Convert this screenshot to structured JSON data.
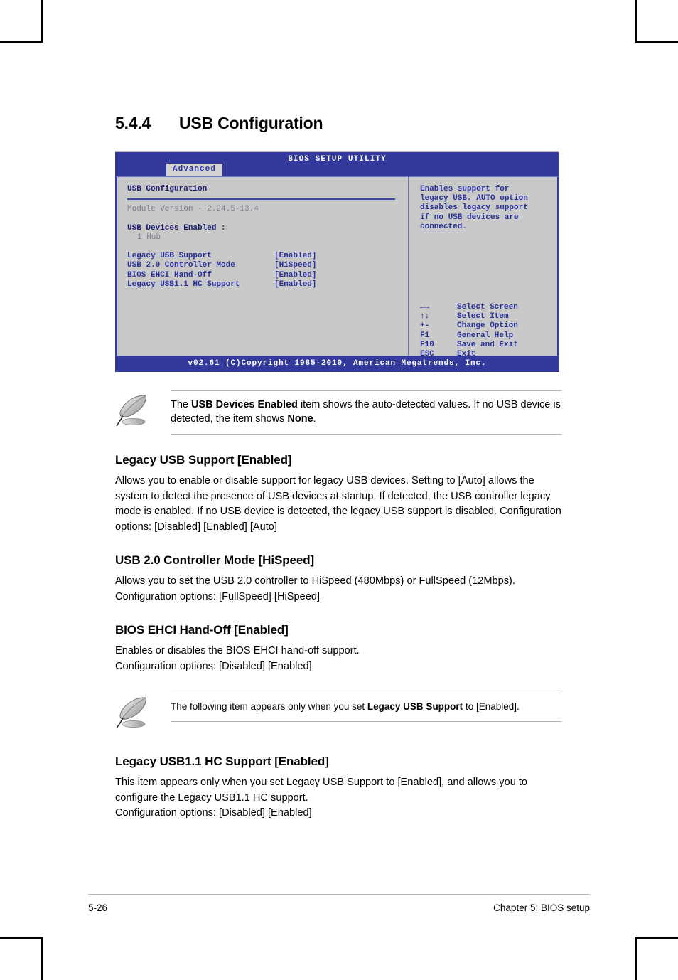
{
  "section": {
    "number": "5.4.4",
    "title": "USB Configuration"
  },
  "bios": {
    "title": "BIOS SETUP UTILITY",
    "active_tab": "Advanced",
    "panel_heading": "USB Configuration",
    "module_version": "Module Version - 2.24.5-13.4",
    "devices_label": "USB Devices Enabled :",
    "devices_value": "1 Hub",
    "options": [
      {
        "name": "Legacy USB Support",
        "value": "[Enabled]"
      },
      {
        "name": "USB 2.0 Controller Mode",
        "value": "[HiSpeed]"
      },
      {
        "name": "BIOS EHCI Hand-Off",
        "value": "[Enabled]"
      },
      {
        "name": "Legacy USB1.1 HC Support",
        "value": "[Enabled]"
      }
    ],
    "help": "Enables support for legacy USB. AUTO option disables legacy support if no USB devices are connected.",
    "keys": [
      {
        "key": "←→",
        "desc": "Select Screen"
      },
      {
        "key": "↑↓",
        "desc": "Select Item"
      },
      {
        "key": "+-",
        "desc": "Change Option"
      },
      {
        "key": "F1",
        "desc": "General Help"
      },
      {
        "key": "F10",
        "desc": "Save and Exit"
      },
      {
        "key": "ESC",
        "desc": "Exit"
      }
    ],
    "footer": "v02.61 (C)Copyright 1985-2010, American Megatrends, Inc.",
    "colors": {
      "bar": "#343a9c",
      "panel_bg": "#c9c9c9",
      "text": "#27309c"
    }
  },
  "note_1": {
    "icon": "quill-pen-icon",
    "text_1": "The ",
    "bold_1": "USB Devices Enabled",
    "text_2": " item shows the auto-detected values. If no USB device is detected, the item shows ",
    "bold_2": "None",
    "text_3": "."
  },
  "items": [
    {
      "heading": "Legacy USB Support [Enabled]",
      "body": "Allows you to enable or disable support for legacy USB devices. Setting to [Auto] allows the system to detect the presence of USB devices at startup. If detected, the USB controller legacy mode is enabled. If no USB device is detected, the legacy USB support is disabled. Configuration options: [Disabled] [Enabled] [Auto]"
    },
    {
      "heading": "USB 2.0 Controller Mode [HiSpeed]",
      "body": "Allows you to set the USB 2.0 controller to HiSpeed (480Mbps) or FullSpeed (12Mbps). Configuration options: [FullSpeed] [HiSpeed]"
    },
    {
      "heading": "BIOS EHCI Hand-Off [Enabled]",
      "body": "Enables or disables the BIOS EHCI hand-off support.\nConfiguration options: [Disabled] [Enabled]"
    },
    {
      "heading": "Legacy USB1.1 HC Support [Enabled]",
      "body": "This item appears only when you set Legacy USB Support to [Enabled], and allows you to configure the Legacy USB1.1 HC support.\nConfiguration options: [Disabled] [Enabled]"
    }
  ],
  "note_2": {
    "icon": "quill-pen-icon",
    "text_1": "The following item appears only when you set ",
    "bold_1": "Legacy USB Support",
    "text_2": " to [Enabled]."
  },
  "page_footer": {
    "page_number": "5-26",
    "chapter": "Chapter 5: BIOS setup"
  }
}
